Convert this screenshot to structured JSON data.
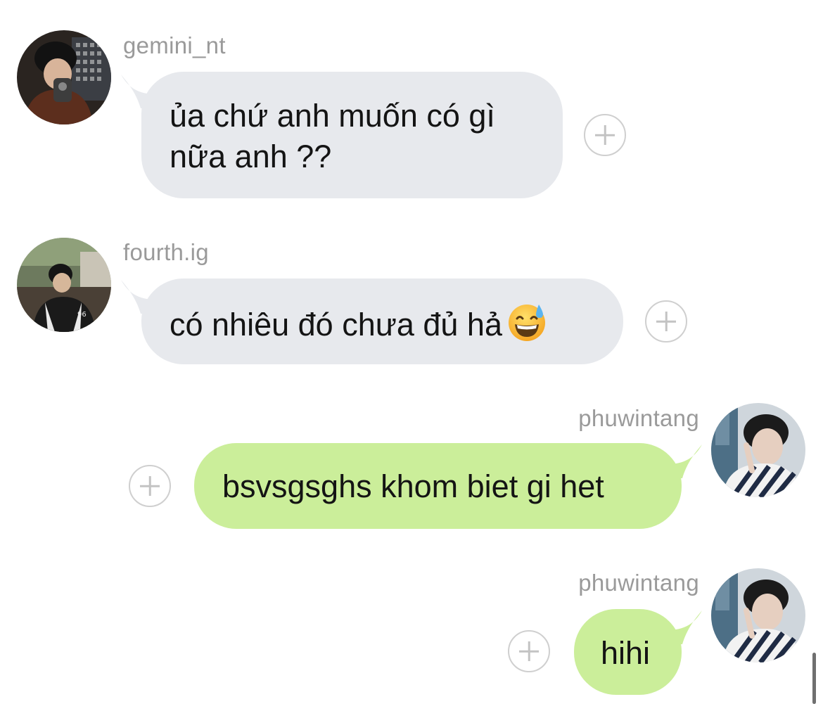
{
  "messages": [
    {
      "direction": "incoming",
      "username": "gemini_nt",
      "text": "ủa chứ anh muốn có gì\nnữa anh ??",
      "avatar": "avatar-gemini-nt"
    },
    {
      "direction": "incoming",
      "username": "fourth.ig",
      "text": "có nhiêu đó chưa đủ hả",
      "emoji": "grinning-face-with-sweat",
      "avatar": "avatar-fourth-ig"
    },
    {
      "direction": "outgoing",
      "username": "phuwintang",
      "text": "bsvsgsghs khom biet gi het",
      "avatar": "avatar-phuwintang"
    },
    {
      "direction": "outgoing",
      "username": "phuwintang",
      "text": "hihi",
      "avatar": "avatar-phuwintang"
    }
  ],
  "icons": {
    "react": "add-reaction-icon",
    "emoji": "grinning-face-with-sweat"
  },
  "colors": {
    "incoming_bubble": "#e7e9ed",
    "outgoing_bubble": "#cbee9a",
    "username": "#9a9a9a",
    "text": "#141414"
  }
}
